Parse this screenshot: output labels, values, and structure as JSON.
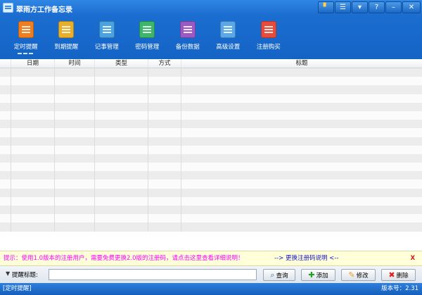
{
  "window": {
    "title": "翠雨方工作备忘录",
    "icon": "app-icon",
    "controls": [
      {
        "name": "skin-button",
        "glyph": "▘"
      },
      {
        "name": "menu-button",
        "glyph": "☰"
      },
      {
        "name": "dropdown-button",
        "glyph": "▾"
      },
      {
        "name": "help-button",
        "glyph": "?"
      },
      {
        "name": "minimize-button",
        "glyph": "–"
      },
      {
        "name": "close-button",
        "glyph": "✕"
      }
    ]
  },
  "toolbar": {
    "items": [
      {
        "label": "定时提醒",
        "icon": "clock-calendar-icon",
        "color": "#f07e1e",
        "active": true
      },
      {
        "label": "到期提醒",
        "icon": "calendar-check-icon",
        "color": "#e8b02a",
        "active": false
      },
      {
        "label": "记事管理",
        "icon": "notepad-icon",
        "color": "#4aa3e0",
        "active": false
      },
      {
        "label": "密码管理",
        "icon": "password-lock-icon",
        "color": "#3bb66a",
        "active": false
      },
      {
        "label": "备份数据",
        "icon": "backup-database-icon",
        "color": "#9b59c6",
        "active": false
      },
      {
        "label": "高级设置",
        "icon": "settings-gear-icon",
        "color": "#5aa8e8",
        "active": false
      },
      {
        "label": "注册购买",
        "icon": "register-buy-icon",
        "color": "#e84b3b",
        "active": false
      }
    ]
  },
  "table": {
    "columns": [
      "",
      "日期",
      "时间",
      "类型",
      "方式",
      "标题"
    ],
    "row_count": 19
  },
  "notice": {
    "text": "提示：使用1.0版本的注册用户，需要免费更换2.0版的注册码，请点击这里查看详细说明！",
    "link": "--> 更换注册码说明 <--",
    "close": "X"
  },
  "controls": {
    "label": "提醒标题:",
    "input_value": "",
    "buttons": {
      "query": "查询",
      "add": "添加",
      "edit": "修改",
      "delete": "删除"
    }
  },
  "status": {
    "left": "[定时提醒]",
    "right": "版本号：2.31"
  }
}
